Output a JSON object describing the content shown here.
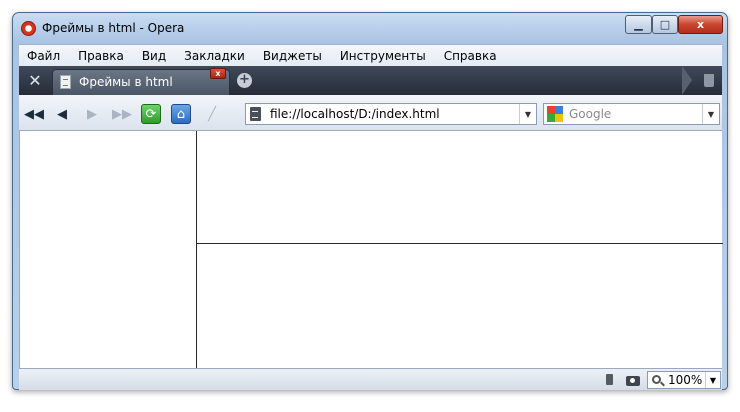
{
  "window": {
    "title": "Фреймы в html - Opera",
    "minimize_glyph": "▁",
    "maximize_glyph": "□",
    "close_glyph": "x"
  },
  "menubar": {
    "items": [
      "Файл",
      "Правка",
      "Вид",
      "Закладки",
      "Виджеты",
      "Инструменты",
      "Справка"
    ]
  },
  "tabs": {
    "tools_glyph": "✕",
    "active_label": "Фреймы в html",
    "close_glyph": "x",
    "new_tab_glyph": "+"
  },
  "navigation": {
    "rewind_glyph": "◀◀",
    "back_glyph": "◀",
    "forward_glyph": "▶",
    "fast_forward_glyph": "▶▶",
    "reload_glyph": "⟳",
    "home_glyph": "⌂",
    "edit_glyph": "╱"
  },
  "address": {
    "url": "file://localhost/D:/index.html",
    "dropdown_glyph": "▼"
  },
  "search": {
    "placeholder": "Google",
    "dropdown_glyph": "▼"
  },
  "status": {
    "zoom": "100%",
    "dropdown_glyph": "▼"
  },
  "icons": {
    "app": "opera-logo-icon",
    "tools": "tools-icon",
    "tab_page": "page-icon",
    "trash": "trash-icon",
    "turbo": "turbo-icon",
    "camera": "camera-icon",
    "zoom": "magnifier-icon"
  }
}
